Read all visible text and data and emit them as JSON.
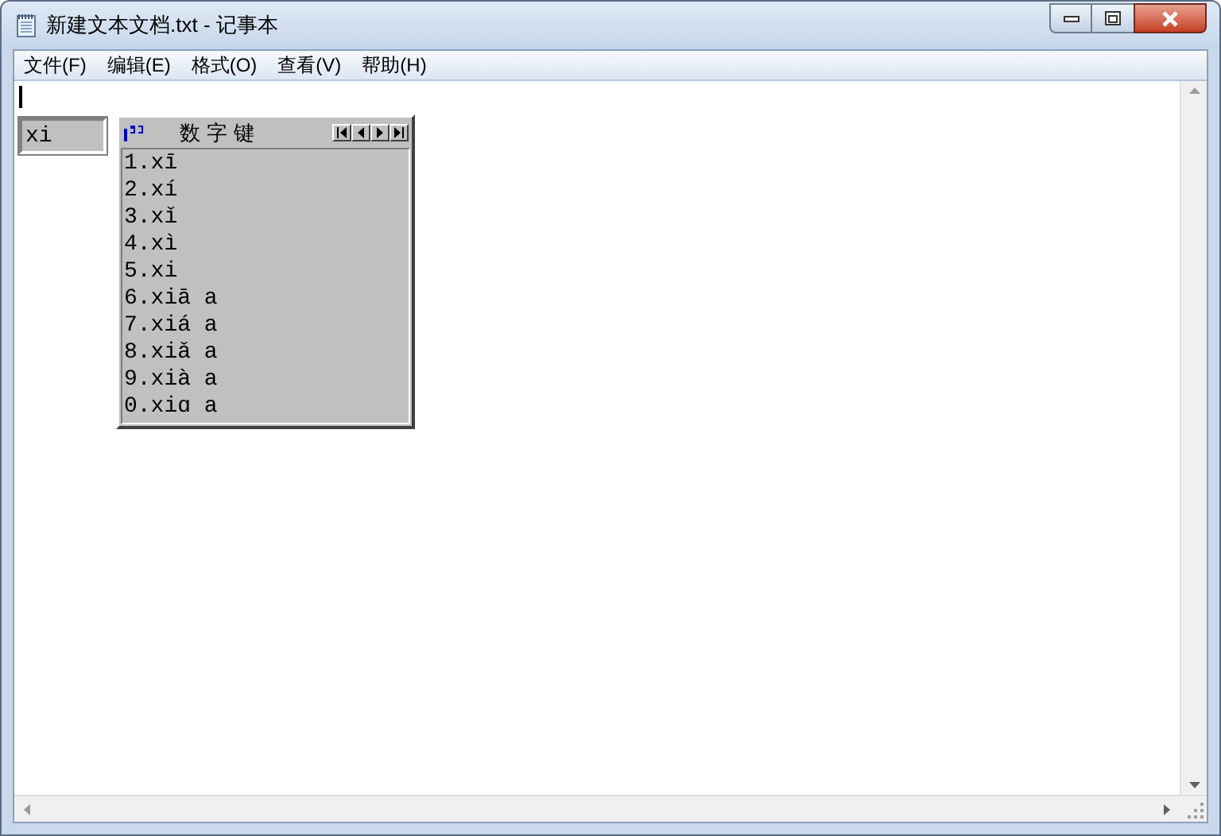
{
  "window": {
    "title": "新建文本文档.txt - 记事本"
  },
  "menu": [
    {
      "label": "文件(F)"
    },
    {
      "label": "编辑(E)"
    },
    {
      "label": "格式(O)"
    },
    {
      "label": "查看(V)"
    },
    {
      "label": "帮助(H)"
    }
  ],
  "ime": {
    "composition": "xi",
    "candidate_window": {
      "title": "数字键",
      "candidates": [
        {
          "text": "1.xī"
        },
        {
          "text": "2.xí"
        },
        {
          "text": "3.xǐ"
        },
        {
          "text": "4.xì"
        },
        {
          "text": "5.xi"
        },
        {
          "text": "6.xiā a"
        },
        {
          "text": "7.xiá a"
        },
        {
          "text": "8.xiǎ a"
        },
        {
          "text": "9.xià a"
        },
        {
          "text": "0.xiɑ a"
        }
      ]
    }
  }
}
